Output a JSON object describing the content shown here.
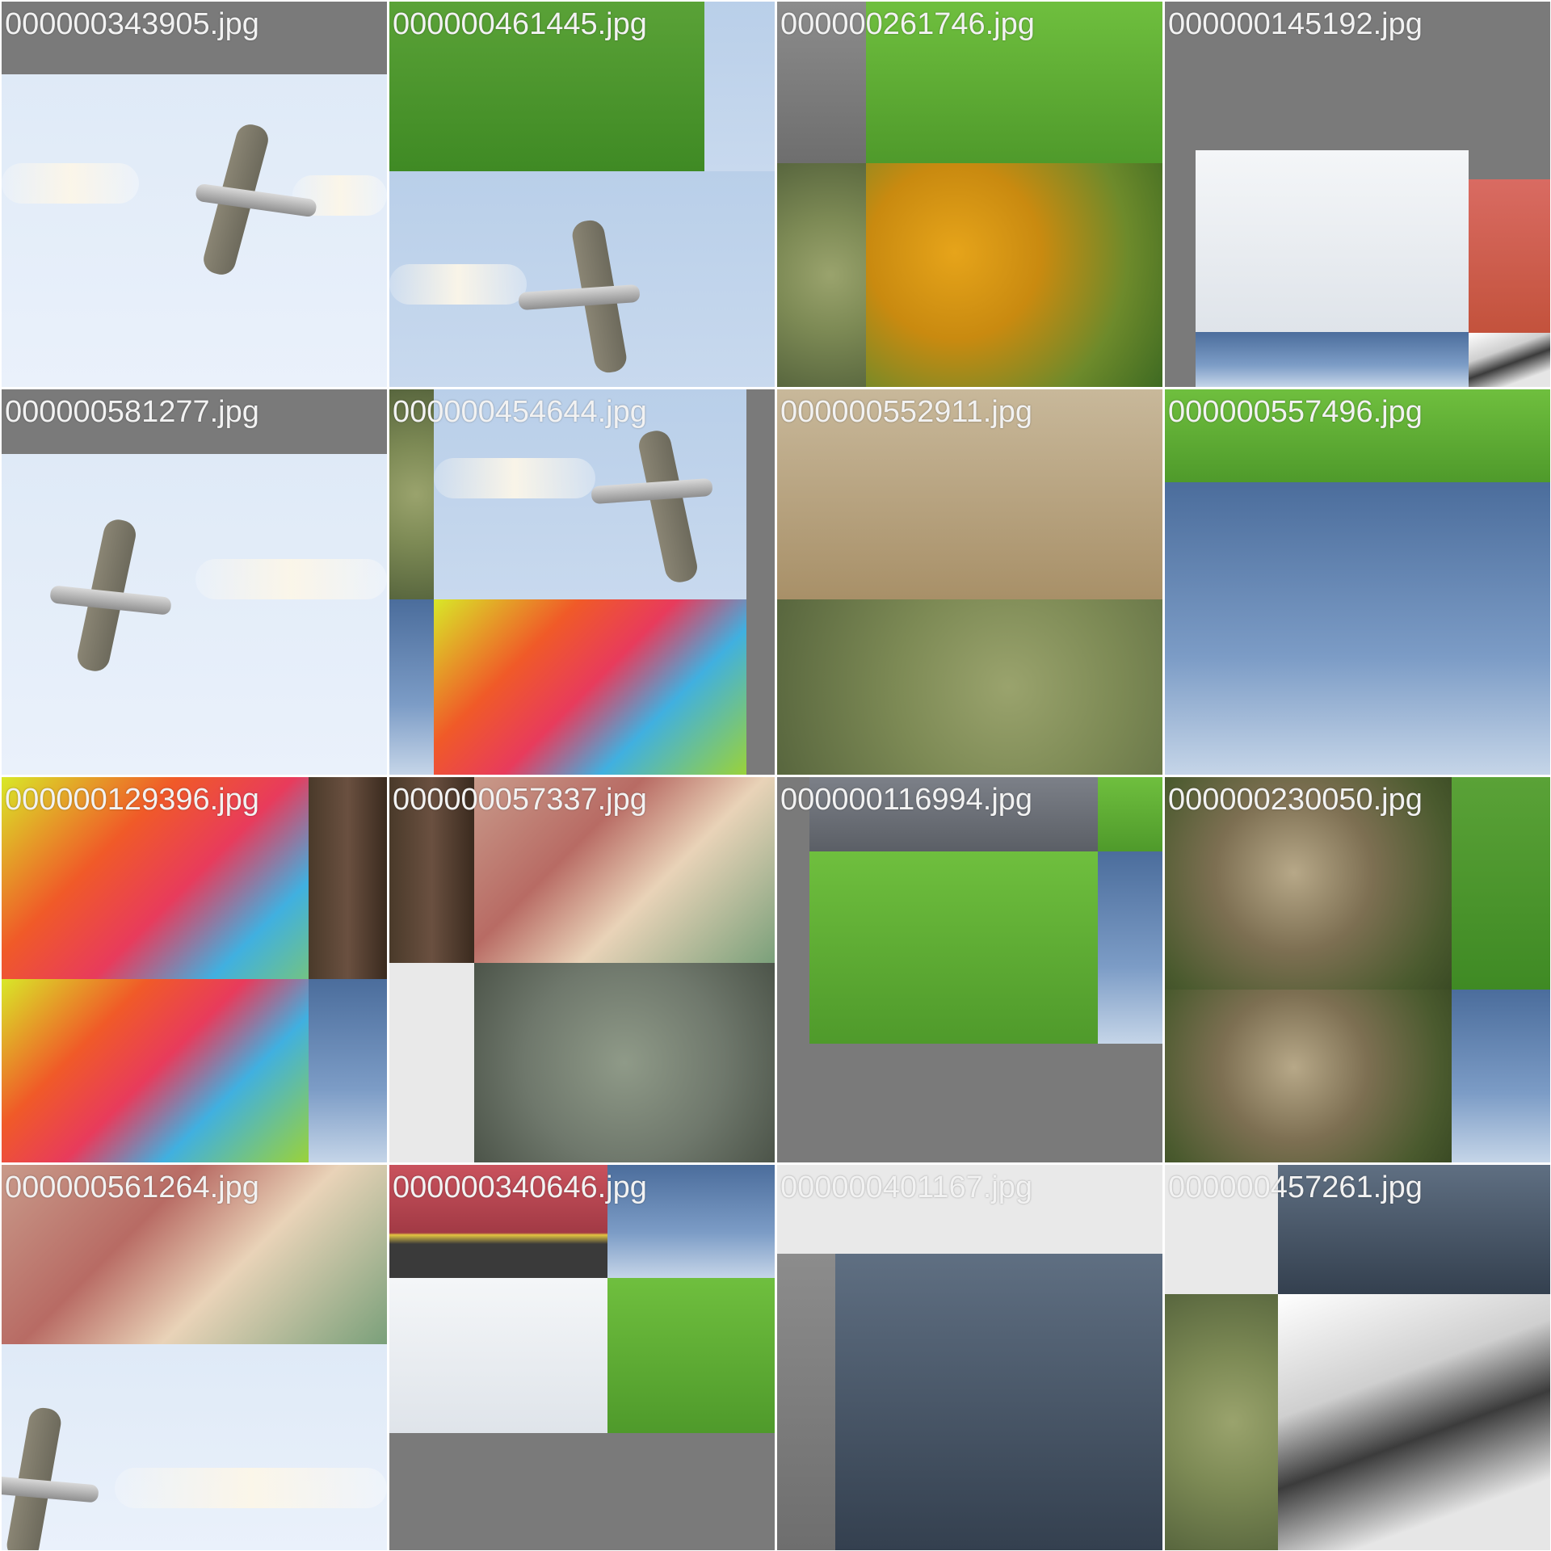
{
  "tiles": [
    {
      "label": "000000343905.jpg"
    },
    {
      "label": "000000461445.jpg"
    },
    {
      "label": "000000261746.jpg"
    },
    {
      "label": "000000145192.jpg"
    },
    {
      "label": "000000581277.jpg"
    },
    {
      "label": "000000454644.jpg"
    },
    {
      "label": "000000552911.jpg"
    },
    {
      "label": "000000557496.jpg"
    },
    {
      "label": "000000129396.jpg"
    },
    {
      "label": "000000057337.jpg"
    },
    {
      "label": "000000116994.jpg"
    },
    {
      "label": "000000230050.jpg"
    },
    {
      "label": "000000561264.jpg"
    },
    {
      "label": "000000340646.jpg"
    },
    {
      "label": "000000401167.jpg"
    },
    {
      "label": "000000457261.jpg"
    }
  ]
}
